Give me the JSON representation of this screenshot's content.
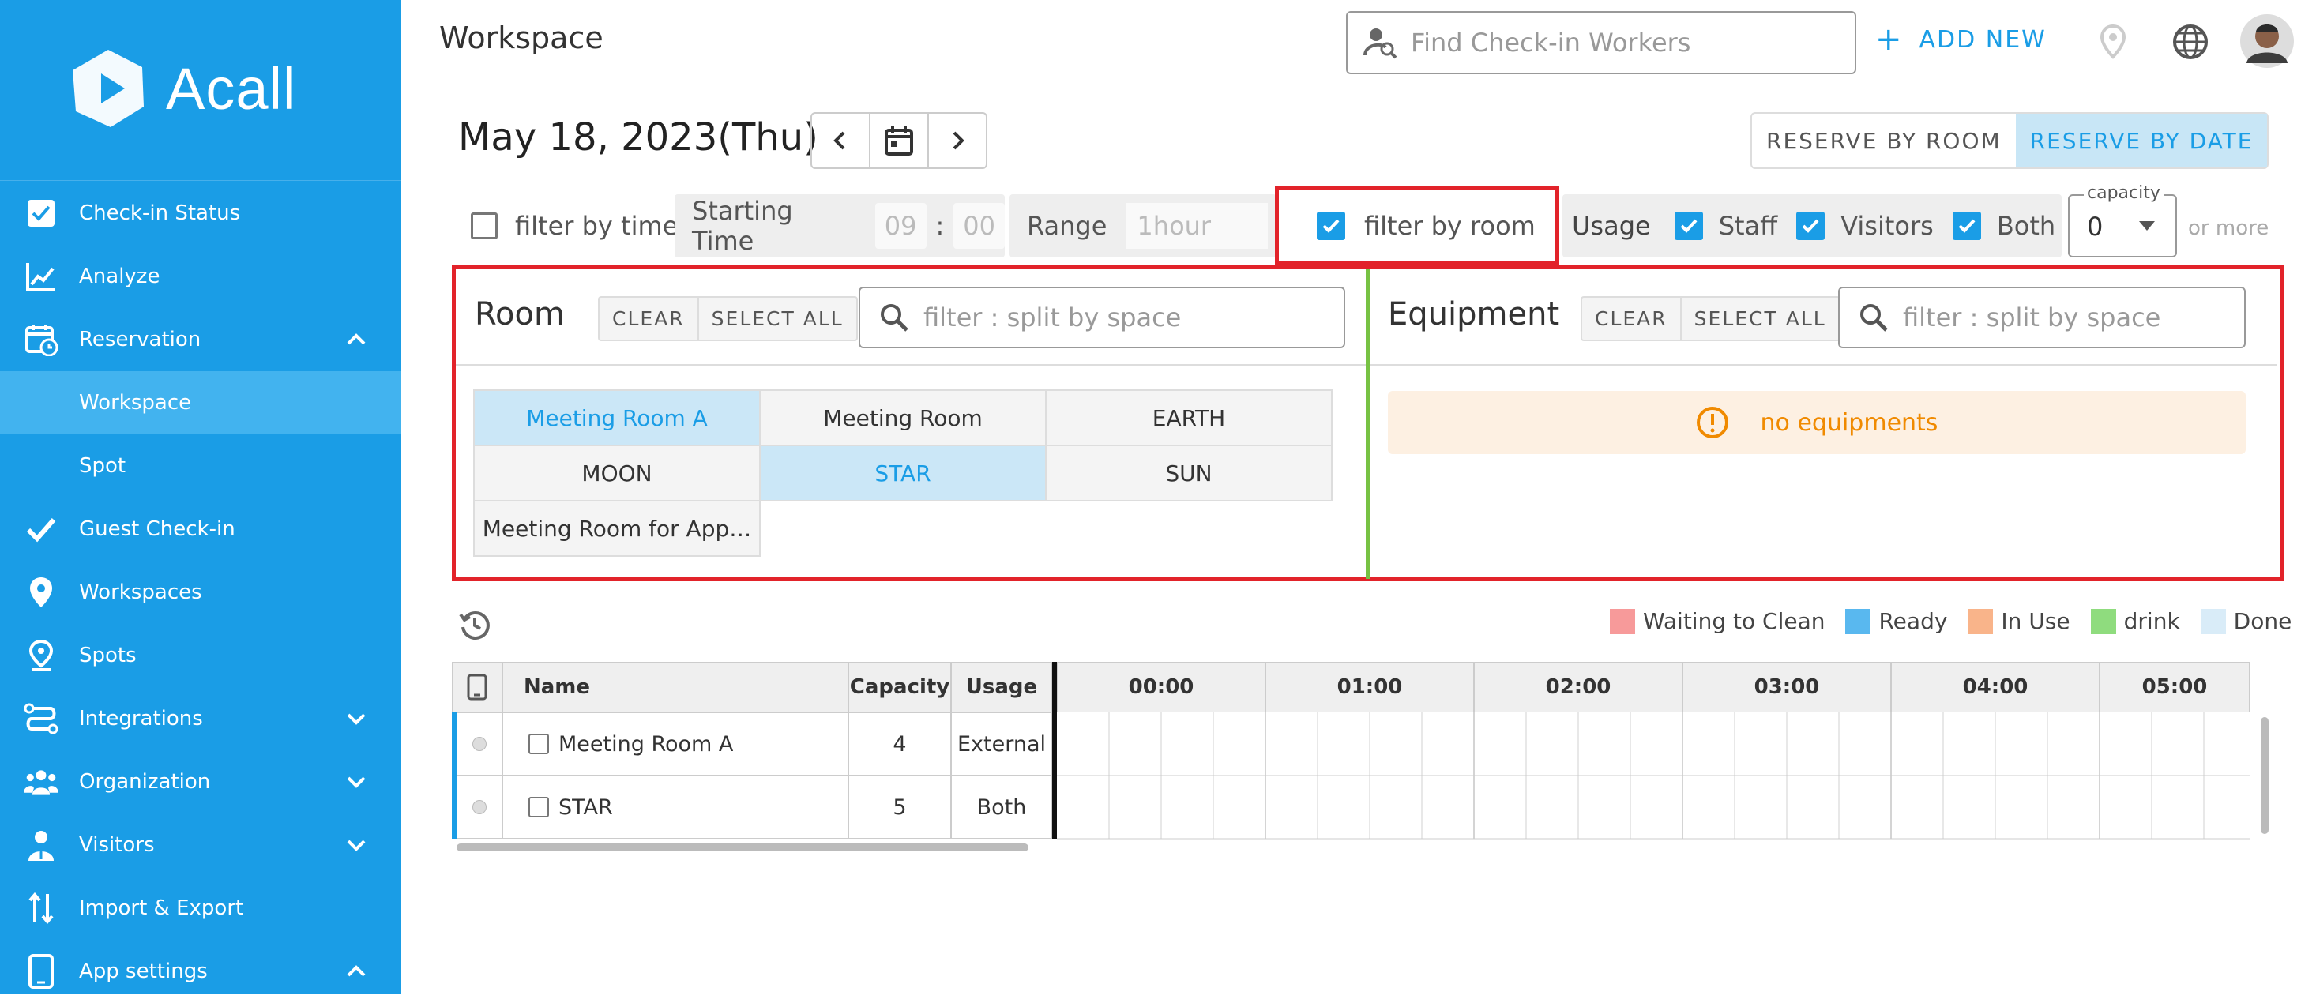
{
  "brand": {
    "name": "Acall"
  },
  "sidebar": {
    "items": [
      {
        "label": "Check-in Status",
        "icon": "checkbox-icon"
      },
      {
        "label": "Analyze",
        "icon": "chart-icon"
      },
      {
        "label": "Reservation",
        "icon": "calendar-clock-icon",
        "expanded": true
      },
      {
        "label": "Workspace",
        "sub": true,
        "active": true
      },
      {
        "label": "Spot",
        "sub": true
      },
      {
        "label": "Guest Check-in",
        "icon": "check-icon"
      },
      {
        "label": "Workspaces",
        "icon": "location-pin-icon"
      },
      {
        "label": "Spots",
        "icon": "location-pin-outline-icon"
      },
      {
        "label": "Integrations",
        "icon": "integrations-icon",
        "collapsed": true
      },
      {
        "label": "Organization",
        "icon": "people-icon",
        "collapsed": true
      },
      {
        "label": "Visitors",
        "icon": "visitor-icon",
        "collapsed": true
      },
      {
        "label": "Import & Export",
        "icon": "import-export-icon"
      },
      {
        "label": "App settings",
        "icon": "tablet-icon",
        "expanded": true
      }
    ]
  },
  "header": {
    "title": "Workspace",
    "search_placeholder": "Find Check-in Workers",
    "add_new": "ADD NEW"
  },
  "datebar": {
    "date": "May 18, 2023(Thu)",
    "reserve_by_room": "RESERVE BY ROOM",
    "reserve_by_date": "RESERVE BY DATE"
  },
  "filters": {
    "filter_by_time": "filter by time",
    "starting_time_label": "Starting Time",
    "hour": "09",
    "colon": ":",
    "minute": "00",
    "range_label": "Range",
    "range_value": "1hour",
    "filter_by_room": "filter by room",
    "usage_label": "Usage",
    "staff": "Staff",
    "visitors": "Visitors",
    "both": "Both",
    "capacity_label": "capacity",
    "capacity_value": "0",
    "or_more": "or more"
  },
  "room_panel": {
    "title": "Room",
    "clear": "CLEAR",
    "select_all": "SELECT ALL",
    "filter_placeholder": "filter : split by space",
    "rooms": [
      {
        "name": "Meeting Room A",
        "selected": true
      },
      {
        "name": "Meeting Room",
        "selected": false
      },
      {
        "name": "EARTH",
        "selected": false
      },
      {
        "name": "MOON",
        "selected": false
      },
      {
        "name": "STAR",
        "selected": true
      },
      {
        "name": "SUN",
        "selected": false
      },
      {
        "name": "Meeting Room for App…",
        "selected": false
      }
    ]
  },
  "equipment_panel": {
    "title": "Equipment",
    "clear": "CLEAR",
    "select_all": "SELECT ALL",
    "filter_placeholder": "filter : split by space",
    "empty_message": "no equipments"
  },
  "legend": [
    {
      "label": "Waiting to Clean",
      "color": "#f79a9a"
    },
    {
      "label": "Ready",
      "color": "#59b8ef"
    },
    {
      "label": "In Use",
      "color": "#f9b48a"
    },
    {
      "label": "drink",
      "color": "#8fdc7e"
    },
    {
      "label": "Done",
      "color": "#d9ecf8"
    }
  ],
  "table": {
    "headers": {
      "name": "Name",
      "capacity": "Capacity",
      "usage": "Usage"
    },
    "times": [
      "00:00",
      "01:00",
      "02:00",
      "03:00",
      "04:00",
      "05:00"
    ],
    "rows": [
      {
        "name": "Meeting Room A",
        "capacity": "4",
        "usage": "External"
      },
      {
        "name": "STAR",
        "capacity": "5",
        "usage": "Both"
      }
    ]
  },
  "colors": {
    "sidebar": "#1a9de6",
    "accent": "#1a9de6",
    "highlight": "#e2232a",
    "divider": "#77c243"
  }
}
